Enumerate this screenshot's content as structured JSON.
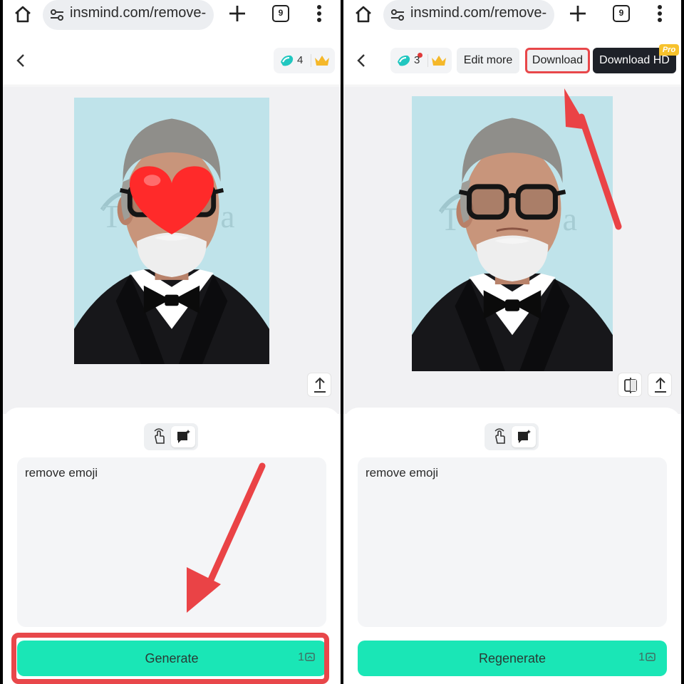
{
  "left": {
    "browser": {
      "url": "insmind.com/remove-",
      "tab_count": "9"
    },
    "header": {
      "credits": "4"
    },
    "prompt": {
      "text": "remove emoji"
    },
    "action": {
      "label": "Generate",
      "cost": "1"
    }
  },
  "right": {
    "browser": {
      "url": "insmind.com/remove-",
      "tab_count": "9"
    },
    "header": {
      "credits": "3",
      "edit_more": "Edit more",
      "download": "Download",
      "download_hd": "Download HD",
      "pro_badge": "Pro"
    },
    "prompt": {
      "text": "remove emoji"
    },
    "action": {
      "label": "Regenerate",
      "cost": "1"
    }
  },
  "colors": {
    "accent": "#1ae6b6",
    "highlight": "#e8474a",
    "dark_button": "#1e2128",
    "pro_badge": "#f7c22c",
    "emoji_heart": "#ff2a2a",
    "photo_background": "#bfe3ea"
  },
  "icons": [
    "home-icon",
    "tune-icon",
    "plus-icon",
    "tabs-icon",
    "more-vert-icon",
    "back-icon",
    "gem-icon",
    "crown-icon",
    "share-icon",
    "compare-icon",
    "tap-icon",
    "chat-icon",
    "credit-icon",
    "heart-emoji"
  ]
}
